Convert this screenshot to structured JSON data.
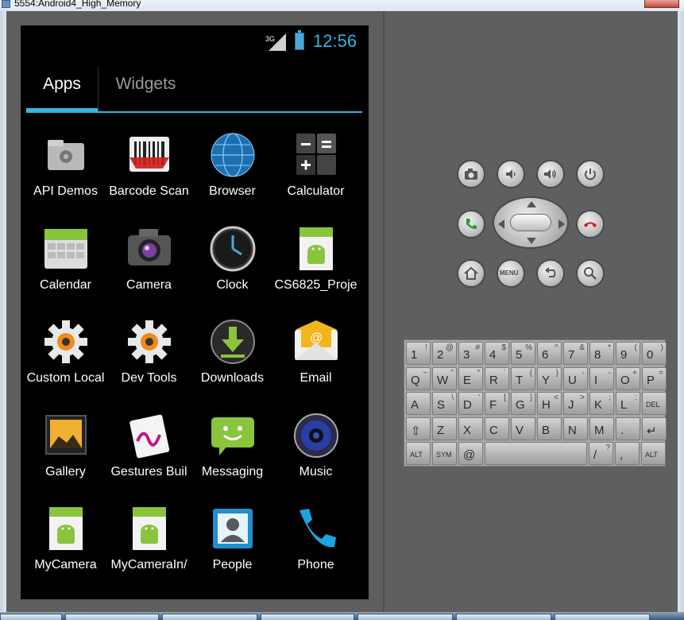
{
  "window": {
    "title": "5554:Android4_High_Memory"
  },
  "statusbar": {
    "network": "3G",
    "time": "12:56"
  },
  "tabs": [
    {
      "label": "Apps"
    },
    {
      "label": "Widgets"
    }
  ],
  "apps": [
    {
      "label": "API Demos",
      "icon": "folder-gear-icon"
    },
    {
      "label": "Barcode Scan",
      "icon": "barcode-icon"
    },
    {
      "label": "Browser",
      "icon": "globe-icon"
    },
    {
      "label": "Calculator",
      "icon": "calculator-icon"
    },
    {
      "label": "Calendar",
      "icon": "calendar-icon"
    },
    {
      "label": "Camera",
      "icon": "camera-icon"
    },
    {
      "label": "Clock",
      "icon": "clock-icon"
    },
    {
      "label": "CS6825_Proje",
      "icon": "android-icon"
    },
    {
      "label": "Custom Local",
      "icon": "gear-icon"
    },
    {
      "label": "Dev Tools",
      "icon": "gear-icon"
    },
    {
      "label": "Downloads",
      "icon": "download-icon"
    },
    {
      "label": "Email",
      "icon": "email-icon"
    },
    {
      "label": "Gallery",
      "icon": "gallery-icon"
    },
    {
      "label": "Gestures Buil",
      "icon": "gesture-icon"
    },
    {
      "label": "Messaging",
      "icon": "message-icon"
    },
    {
      "label": "Music",
      "icon": "speaker-icon"
    },
    {
      "label": "MyCamera",
      "icon": "android-icon"
    },
    {
      "label": "MyCameraIn/",
      "icon": "android-icon"
    },
    {
      "label": "People",
      "icon": "contact-icon"
    },
    {
      "label": "Phone",
      "icon": "phone-icon"
    }
  ],
  "hardware": {
    "dpad_center": "",
    "menu_label": "MENU"
  },
  "keyboard": {
    "rows": [
      [
        [
          "1",
          "!"
        ],
        [
          "2",
          "@"
        ],
        [
          "3",
          "#"
        ],
        [
          "4",
          "$"
        ],
        [
          "5",
          "%"
        ],
        [
          "6",
          "^"
        ],
        [
          "7",
          "&"
        ],
        [
          "8",
          "*"
        ],
        [
          "9",
          "("
        ],
        [
          "0",
          ")"
        ]
      ],
      [
        [
          "Q",
          "~"
        ],
        [
          "W",
          "\""
        ],
        [
          "E",
          "\""
        ],
        [
          "R",
          "`"
        ],
        [
          "T",
          "{"
        ],
        [
          "Y",
          "}"
        ],
        [
          "U",
          "-"
        ],
        [
          "I",
          "-"
        ],
        [
          "O",
          "+"
        ],
        [
          "P",
          "="
        ]
      ],
      [
        [
          "A",
          ""
        ],
        [
          "S",
          "\\"
        ],
        [
          "D",
          "'"
        ],
        [
          "F",
          "["
        ],
        [
          "G",
          "]"
        ],
        [
          "H",
          "<"
        ],
        [
          "J",
          ">"
        ],
        [
          "K",
          ";"
        ],
        [
          "L",
          ":"
        ],
        [
          "DEL",
          ""
        ]
      ],
      [
        [
          "⇧",
          ""
        ],
        [
          "Z",
          ""
        ],
        [
          "X",
          ""
        ],
        [
          "C",
          ""
        ],
        [
          "V",
          ""
        ],
        [
          "B",
          ""
        ],
        [
          "N",
          ""
        ],
        [
          "M",
          ""
        ],
        [
          ".",
          ""
        ],
        [
          "↵",
          ""
        ]
      ],
      [
        [
          "ALT",
          ""
        ],
        [
          "SYM",
          ""
        ],
        [
          "@",
          ""
        ],
        [
          "",
          ""
        ],
        [
          "/",
          "?"
        ],
        [
          ",",
          ""
        ],
        [
          "ALT",
          ""
        ]
      ]
    ]
  },
  "colors": {
    "accent": "#33b5e5",
    "screen_bg": "#000000",
    "panel_bg": "#5f5f5f"
  }
}
